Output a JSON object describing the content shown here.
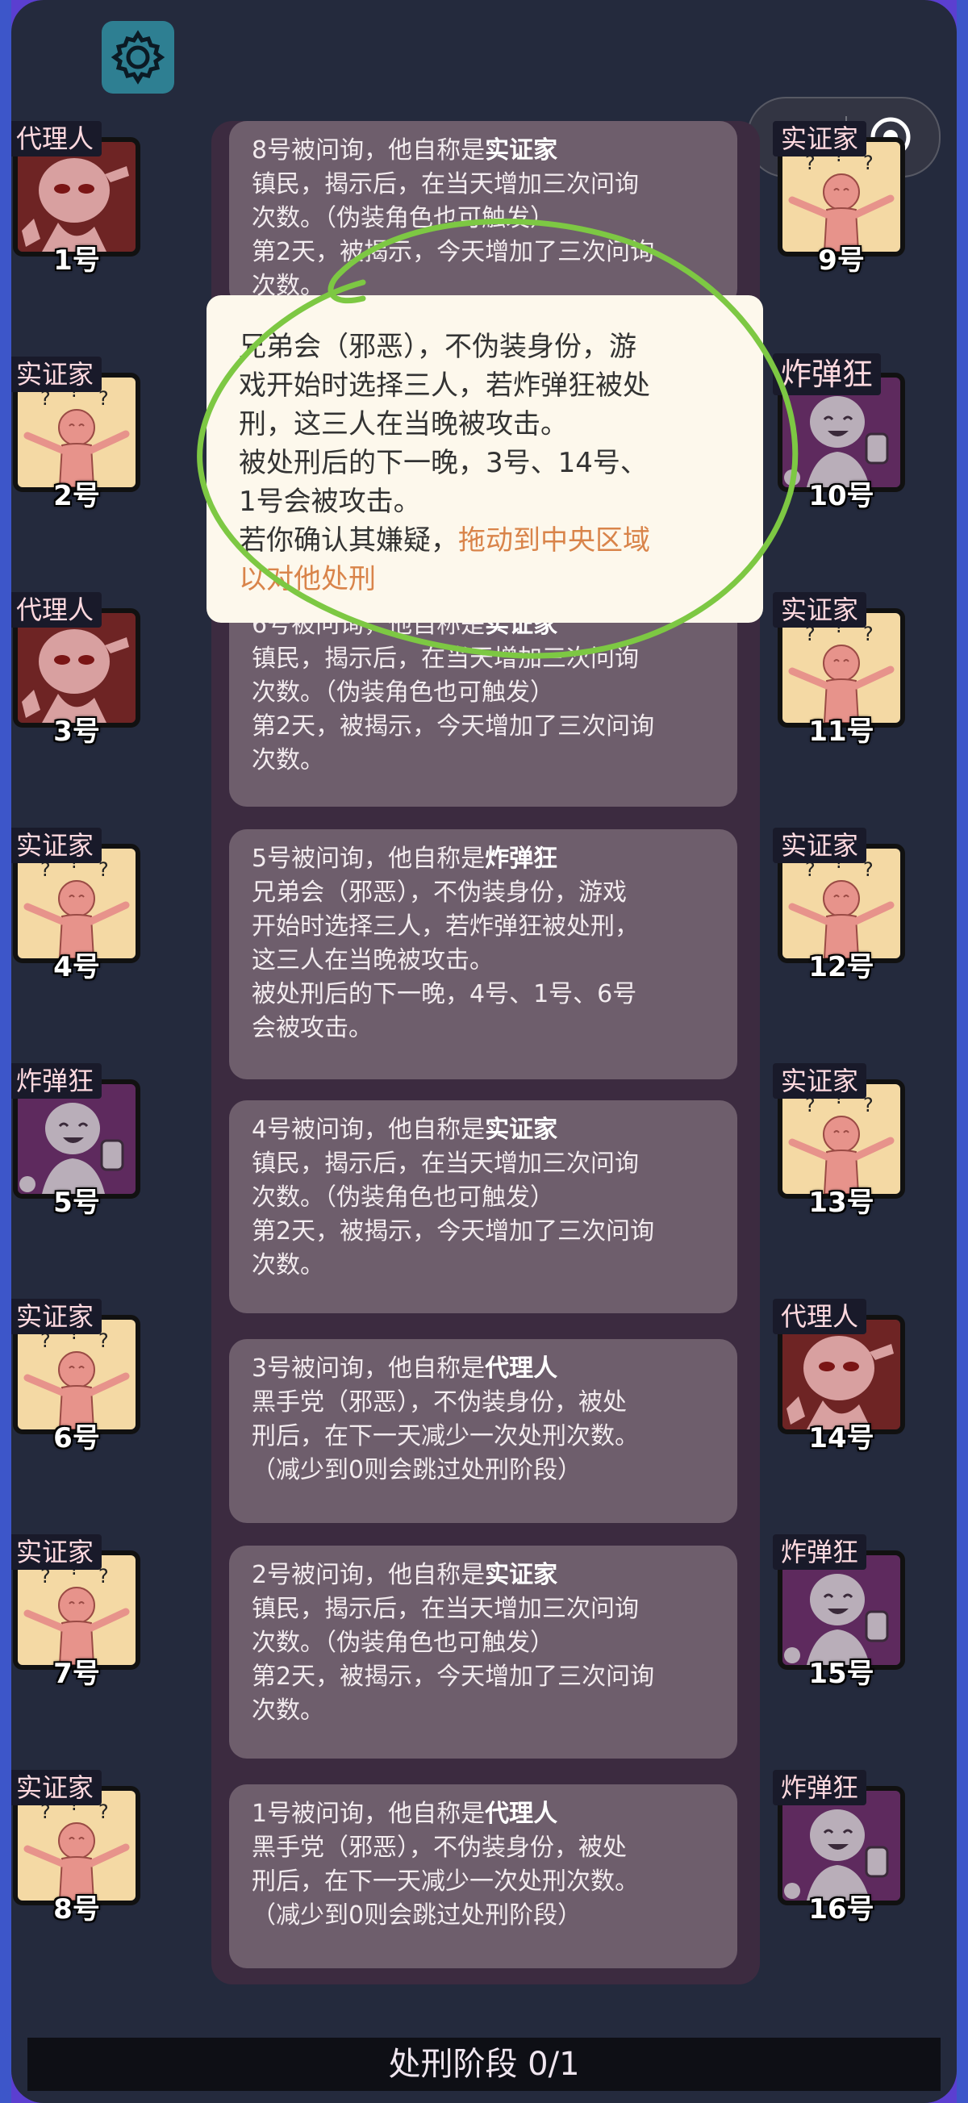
{
  "phase": {
    "label": "处刑阶段 0/1"
  },
  "settings_icon": "gear-icon",
  "capsule": {
    "more_icon": "more-dots-icon",
    "close_icon": "target-icon"
  },
  "left_players": [
    {
      "role": "代理人",
      "number": "1号",
      "art": "agent"
    },
    {
      "role": "实证家",
      "number": "2号",
      "art": "empiricist"
    },
    {
      "role": "代理人",
      "number": "3号",
      "art": "agent"
    },
    {
      "role": "实证家",
      "number": "4号",
      "art": "empiricist"
    },
    {
      "role": "炸弹狂",
      "number": "5号",
      "art": "bomber"
    },
    {
      "role": "实证家",
      "number": "6号",
      "art": "empiricist"
    },
    {
      "role": "实证家",
      "number": "7号",
      "art": "empiricist"
    },
    {
      "role": "实证家",
      "number": "8号",
      "art": "empiricist"
    }
  ],
  "right_players": [
    {
      "role": "实证家",
      "number": "9号",
      "art": "empiricist"
    },
    {
      "role": "炸弹狂",
      "number": "10号",
      "art": "bomber"
    },
    {
      "role": "实证家",
      "number": "11号",
      "art": "empiricist"
    },
    {
      "role": "实证家",
      "number": "12号",
      "art": "empiricist"
    },
    {
      "role": "实证家",
      "number": "13号",
      "art": "empiricist"
    },
    {
      "role": "代理人",
      "number": "14号",
      "art": "agent"
    },
    {
      "role": "炸弹狂",
      "number": "15号",
      "art": "bomber"
    },
    {
      "role": "炸弹狂",
      "number": "16号",
      "art": "bomber"
    }
  ],
  "logs": [
    {
      "intro": "8号被问询，他自称是",
      "claim": "实证家",
      "lines": [
        "镇民，揭示后，在当天增加三次问询",
        "次数。（伪装角色也可触发）",
        "第2天，被揭示，今天增加了三次问询",
        "次数。"
      ]
    },
    {
      "intro": "6号被问询，他自称是",
      "claim": "实证家",
      "lines": [
        "镇民，揭示后，在当天增加三次问询",
        "次数。（伪装角色也可触发）",
        "第2天，被揭示，今天增加了三次问询",
        "次数。"
      ]
    },
    {
      "intro": "5号被问询，他自称是",
      "claim": "炸弹狂",
      "lines": [
        "兄弟会（邪恶），不伪装身份，游戏",
        "开始时选择三人，若炸弹狂被处刑，",
        "这三人在当晚被攻击。",
        "被处刑后的下一晚，4号、1号、6号",
        "会被攻击。"
      ]
    },
    {
      "intro": "4号被问询，他自称是",
      "claim": "实证家",
      "lines": [
        "镇民，揭示后，在当天增加三次问询",
        "次数。（伪装角色也可触发）",
        "第2天，被揭示，今天增加了三次问询",
        "次数。"
      ]
    },
    {
      "intro": "3号被问询，他自称是",
      "claim": "代理人",
      "lines": [
        "黑手党（邪恶），不伪装身份，被处",
        "刑后，在下一天减少一次处刑次数。",
        "（减少到0则会跳过处刑阶段）"
      ]
    },
    {
      "intro": "2号被问询，他自称是",
      "claim": "实证家",
      "lines": [
        "镇民，揭示后，在当天增加三次问询",
        "次数。（伪装角色也可触发）",
        "第2天，被揭示，今天增加了三次问询",
        "次数。"
      ]
    },
    {
      "intro": "1号被问询，他自称是",
      "claim": "代理人",
      "lines": [
        "黑手党（邪恶），不伪装身份，被处",
        "刑后，在下一天减少一次处刑次数。",
        "（减少到0则会跳过处刑阶段）"
      ]
    }
  ],
  "tooltip": {
    "lines": [
      "兄弟会（邪恶），不伪装身份，游",
      "戏开始时选择三人，若炸弹狂被处",
      "刑，这三人在当晚被攻击。",
      "被处刑后的下一晚，3号、14号、",
      "1号会被攻击。"
    ],
    "hint_prefix": "若你确认其嫌疑，",
    "hint_action_1": "拖动到中央区域",
    "hint_action_2": "以对他处刑"
  },
  "colors": {
    "agent_bg": "#6e2424",
    "empiricist_bg": "#f4d9a4",
    "bomber_bg": "#5e2a5e",
    "circle": "#7dc843"
  }
}
